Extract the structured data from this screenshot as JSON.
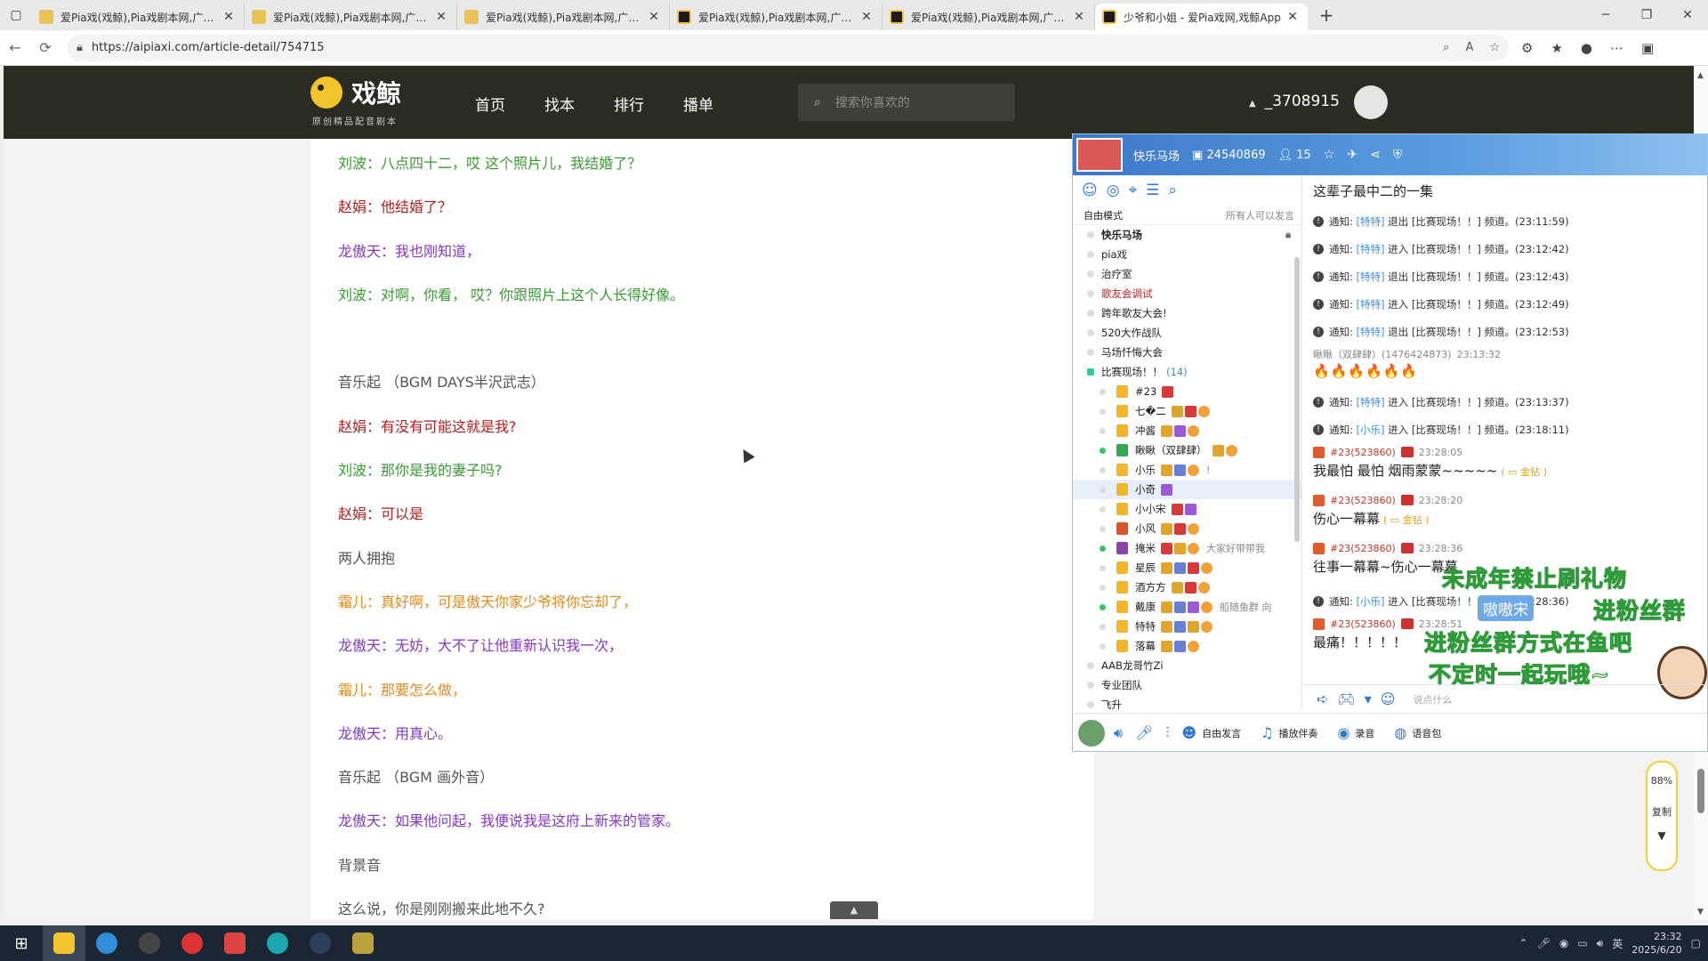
{
  "browser": {
    "tabs": [
      {
        "title": "爱Pia戏(戏鲸),Pia戏剧本网,广播剧",
        "favicon": "doc-icon"
      },
      {
        "title": "爱Pia戏(戏鲸),Pia戏剧本网,广播剧",
        "favicon": "doc-icon"
      },
      {
        "title": "爱Pia戏(戏鲸),Pia戏剧本网,广播剧",
        "favicon": "doc-icon"
      },
      {
        "title": "爱Pia戏(戏鲸),Pia戏剧本网,广播剧",
        "favicon": "whale-icon"
      },
      {
        "title": "爱Pia戏(戏鲸),Pia戏剧本网,广播剧",
        "favicon": "whale-icon"
      },
      {
        "title": "少爷和小姐 - 爱Pia戏网,戏鲸App",
        "favicon": "whale-icon"
      }
    ],
    "url": "https://aipiaxi.com/article-detail/754715"
  },
  "site": {
    "logo_name": "戏鲸",
    "logo_slogan": "原创精品配音剧本",
    "nav": [
      "首页",
      "找本",
      "排行",
      "播单"
    ],
    "search_placeholder": "搜索你喜欢的",
    "user_id": "_3708915"
  },
  "article": {
    "lines": [
      {
        "text": "刘波：八点四十二，哎 这个照片儿，我结婚了？",
        "color": "green"
      },
      {
        "text": "赵娟：他结婚了？",
        "color": "red"
      },
      {
        "text": "龙傲天：我也刚知道，",
        "color": "purple"
      },
      {
        "text": "刘波：对啊，你看， 哎？你跟照片上这个人长得好像。",
        "color": "green"
      },
      {
        "text": "",
        "color": "gray"
      },
      {
        "text": "音乐起 （BGM DAYS半沢武志）",
        "color": "gray"
      },
      {
        "text": "赵娟：有没有可能这就是我?",
        "color": "red"
      },
      {
        "text": "刘波：那你是我的妻子吗?",
        "color": "green"
      },
      {
        "text": "赵娟：可以是",
        "color": "red"
      },
      {
        "text": "两人拥抱",
        "color": "gray"
      },
      {
        "text": "霜儿：真好啊，可是傲天你家少爷将你忘却了，",
        "color": "orange"
      },
      {
        "text": "龙傲天：无妨，大不了让他重新认识我一次，",
        "color": "purple"
      },
      {
        "text": "霜儿：那要怎么做，",
        "color": "orange"
      },
      {
        "text": "龙傲天：用真心。",
        "color": "purple"
      },
      {
        "text": "音乐起 （BGM 画外音）",
        "color": "gray"
      },
      {
        "text": "龙傲天：如果他问起，我便说我是这府上新来的管家。",
        "color": "purple"
      },
      {
        "text": "背景音",
        "color": "gray"
      },
      {
        "text": "这么说，你是刚刚搬来此地不久?",
        "color": "gray"
      }
    ]
  },
  "chat": {
    "room_name": "快乐马场",
    "room_id": "24540869",
    "online_count": "15",
    "mode_label": "自由模式",
    "mode_perm": "所有人可以发言",
    "channels_top": [
      {
        "name": "快乐马场",
        "bold": true
      },
      {
        "name": "pia戏"
      },
      {
        "name": "治疗室"
      },
      {
        "name": "歌友会调试",
        "red": true
      },
      {
        "name": "跨年歌友大会!"
      },
      {
        "name": "520大作战队"
      },
      {
        "name": "马场忏悔大会"
      }
    ],
    "active_channel": {
      "name": "比赛现场！！",
      "count": "(14)"
    },
    "members": [
      {
        "name": "#23",
        "online": false
      },
      {
        "name": "七�二",
        "online": false
      },
      {
        "name": "冲酱",
        "online": false
      },
      {
        "name": "瞅瞅（双肆肆）",
        "online": true
      },
      {
        "name": "小乐",
        "online": false,
        "note": "!"
      },
      {
        "name": "小奇",
        "online": false,
        "selected": true
      },
      {
        "name": "小小宋",
        "online": false
      },
      {
        "name": "小风",
        "online": false
      },
      {
        "name": "掩米",
        "online": true,
        "note": "大家好带带我"
      },
      {
        "name": "星辰",
        "online": false
      },
      {
        "name": "酒方方",
        "online": false
      },
      {
        "name": "戴康",
        "online": true,
        "note": "船随鱼群 向"
      },
      {
        "name": "特特",
        "online": false
      },
      {
        "name": "落幕",
        "online": false
      }
    ],
    "channels_bottom": [
      {
        "name": "AAB龙哥竹Zi"
      },
      {
        "name": "专业团队"
      },
      {
        "name": "飞升"
      }
    ],
    "topic": "这辈子最中二的一集",
    "messages": [
      {
        "kind": "notice",
        "prefix": "通知:",
        "who": "[特特]",
        "text": "退出 [比赛现场！！] 频道。(23:11:59)"
      },
      {
        "kind": "notice",
        "prefix": "通知:",
        "who": "[特特]",
        "text": "进入 [比赛现场！！] 频道。(23:12:42)"
      },
      {
        "kind": "notice",
        "prefix": "通知:",
        "who": "[特特]",
        "text": "退出 [比赛现场！！] 频道。(23:12:43)"
      },
      {
        "kind": "notice",
        "prefix": "通知:",
        "who": "[特特]",
        "text": "进入 [比赛现场！！] 频道。(23:12:49)"
      },
      {
        "kind": "notice",
        "prefix": "通知:",
        "who": "[特特]",
        "text": "退出 [比赛现场！！] 频道。(23:12:53)"
      },
      {
        "kind": "chat",
        "user": "瞅瞅（双肆肆）(1476424873)",
        "time": "23:13:32",
        "body": "🔥🔥🔥🔥🔥🔥",
        "fire": true
      },
      {
        "kind": "notice",
        "prefix": "通知:",
        "who": "[特特]",
        "text": "进入 [比赛现场！！] 频道。(23:13:37)"
      },
      {
        "kind": "notice",
        "prefix": "通知:",
        "who": "[小乐]",
        "text": "进入 [比赛现场！！] 频道。(23:18:11)"
      },
      {
        "kind": "chat",
        "user": "#23(523860)",
        "time": "23:28:05",
        "body": "我最怕 最怕 烟雨蒙蒙~~~~~",
        "gift": "金钻"
      },
      {
        "kind": "chat",
        "user": "#23(523860)",
        "time": "23:28:20",
        "body": "伤心一幕幕",
        "gift": "金钻"
      },
      {
        "kind": "chat",
        "user": "#23(523860)",
        "time": "23:28:36",
        "body": "往事一幕幕~伤心一幕幕"
      },
      {
        "kind": "notice",
        "prefix": "通知:",
        "who": "[小乐]",
        "text": "进入 [比赛现场！！] 频道。(23:28:36)"
      },
      {
        "kind": "chat",
        "user": "#23(523860)",
        "time": "23:28:51",
        "body": "最痛！！！！！"
      }
    ],
    "overlay": {
      "line1": "未成年禁止刷礼物",
      "line2": "进粉丝群",
      "tag": "嗷嗷宋",
      "line3": "进粉丝群方式在鱼吧",
      "line4": "不定时一起玩哦~"
    },
    "input_placeholder": "说点什么",
    "footer": {
      "free_speak": "自由发言",
      "play_accompany": "播放伴奏",
      "record": "录音",
      "voice_pack": "语音包"
    }
  },
  "zoom_widget": {
    "zoom": "88%",
    "copy": "复制"
  },
  "taskbar": {
    "time": "23:32",
    "date": "2025/6/20"
  },
  "colors": {
    "green": "#3a9a32",
    "red": "#b31d1d",
    "purple": "#8437c6",
    "orange": "#e28a19",
    "gray": "#555555",
    "header_bg": "#2b2b22",
    "chat_accent": "#2f77d0"
  }
}
